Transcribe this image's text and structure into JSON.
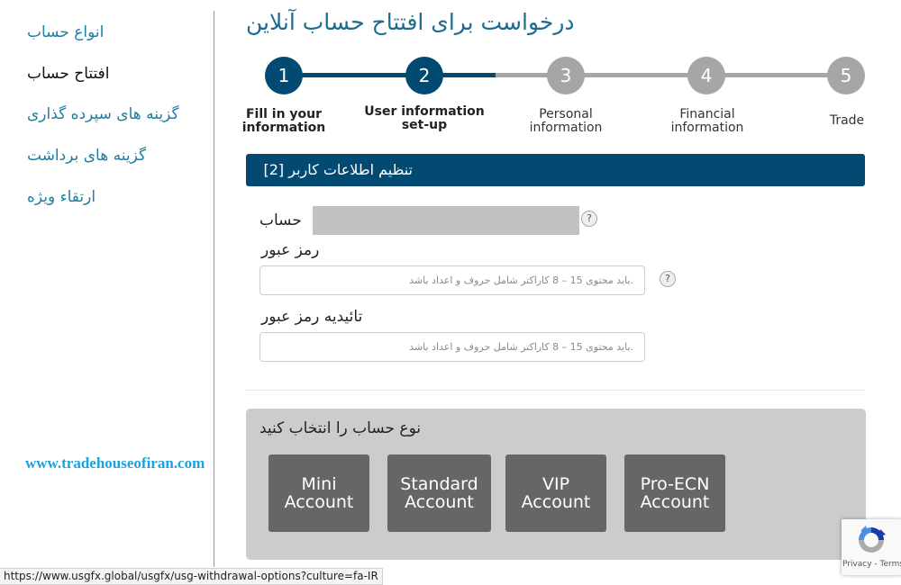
{
  "sidebar": {
    "items": [
      {
        "label": "انواع حساب",
        "active": false
      },
      {
        "label": "افتتاح حساب",
        "active": true
      },
      {
        "label": "گزینه های سپرده گذاری",
        "active": false
      },
      {
        "label": "گزینه های برداشت",
        "active": false
      },
      {
        "label": "ارتقاء ویژه",
        "active": false
      }
    ]
  },
  "watermark": "www.tradehouseofiran.com",
  "page_title": "درخواست برای افتتاح حساب آنلاین",
  "stepper": {
    "current_step": 2,
    "active_color": "#024a72",
    "inactive_color": "#a6a6a6",
    "steps": [
      {
        "number": "1",
        "label_line1": "Fill in your",
        "label_line2": "information"
      },
      {
        "number": "2",
        "label_line1": "User information",
        "label_line2": "set-up"
      },
      {
        "number": "3",
        "label_line1": "Personal",
        "label_line2": "information"
      },
      {
        "number": "4",
        "label_line1": "Financial",
        "label_line2": "information"
      },
      {
        "number": "5",
        "label_line1": "Trade",
        "label_line2": ""
      }
    ]
  },
  "form": {
    "header": "تنظیم اطلاعات کاربر [2]",
    "account_label": "حساب",
    "account_value": "",
    "password_label": "رمز عبور",
    "password_placeholder": ".باید محتوی 15 – 8 کاراکتر شامل حروف و اعداد باشد",
    "confirm_label": "تائیدیه رمز عبور",
    "confirm_placeholder": ".باید محتوی 15 – 8 کاراکتر شامل حروف و اعداد باشد",
    "help_symbol": "?"
  },
  "account_type": {
    "title": "نوع حساب را انتخاب کنید",
    "options": [
      {
        "line1": "Mini",
        "line2": "Account"
      },
      {
        "line1": "Standard",
        "line2": "Account"
      },
      {
        "line1": "VIP",
        "line2": "Account"
      },
      {
        "line1": "Pro-ECN",
        "line2": "Account"
      }
    ]
  },
  "status_bar_url": "https://www.usgfx.global/usgfx/usg-withdrawal-options?culture=fa-IR",
  "recaptcha": {
    "links": "Privacy - Terms"
  }
}
